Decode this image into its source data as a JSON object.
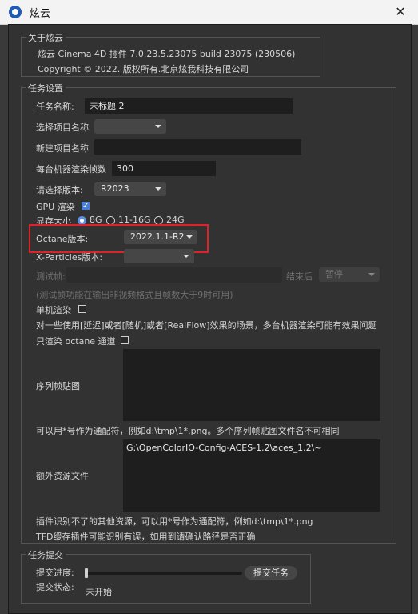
{
  "window": {
    "title": "炫云",
    "close_icon": "✕"
  },
  "about": {
    "group_title": "关于炫云",
    "line1": "炫云 Cinema 4D 插件 7.0.23.5.23075 build 23075  (230506)",
    "line2": "Copyright © 2022. 版权所有.北京炫我科技有限公司"
  },
  "task": {
    "group_title": "任务设置",
    "task_name_label": "任务名称:",
    "task_name_value": "未标题 2",
    "select_project_label": "选择项目名称",
    "select_project_value": "",
    "new_project_label": "新建项目名称",
    "new_project_value": "",
    "frames_label": "每台机器渲染帧数",
    "frames_value": "300",
    "version_label": "请选择版本:",
    "version_value": "R2023",
    "gpu_label": "GPU 渲染",
    "gpu_checked": true,
    "vram_label": "显存大小",
    "vram_options": [
      "8G",
      "11-16G",
      "24G"
    ],
    "vram_selected": "8G",
    "octane_label": "Octane版本:",
    "octane_value": "2022.1.1-R2",
    "xparticles_label": "X-Particles版本:",
    "xparticles_value": "",
    "test_frames_label": "测试帧:",
    "test_frames_value": "",
    "after_end_label": "结束后",
    "after_end_value": "暂停",
    "test_note": "(测试帧功能在输出非视频格式且帧数大于9时可用)",
    "single_machine_label": "单机渲染",
    "single_machine_note": "对一些使用[延迟]或者[随机]或者[RealFlow]效果的场景，多台机器渲染可能有效果问题",
    "octane_only_label": "只渲染 octane 通道",
    "sequence_label": "序列帧贴图",
    "sequence_value": "",
    "sequence_note": "可以用*号作为通配符，例如d:\\tmp\\1*.png。多个序列帧贴图文件名不可相同",
    "extra_label": "额外资源文件",
    "extra_value": "G:\\OpenColorIO-Config-ACES-1.2\\aces_1.2\\~",
    "extra_note1": "插件识别不了的其他资源，可以用*号作为通配符，例如d:\\tmp\\1*.png",
    "extra_note2": "TFD缓存插件可能识别有误，如用到请确认路径是否正确"
  },
  "submit": {
    "group_title": "任务提交",
    "progress_label": "提交进度:",
    "progress_value": 0,
    "status_label": "提交状态:",
    "status_value": "未开始",
    "submit_button": "提交任务"
  },
  "colors": {
    "highlight_box": "#e0212a",
    "accent": "#4a7fd6"
  }
}
